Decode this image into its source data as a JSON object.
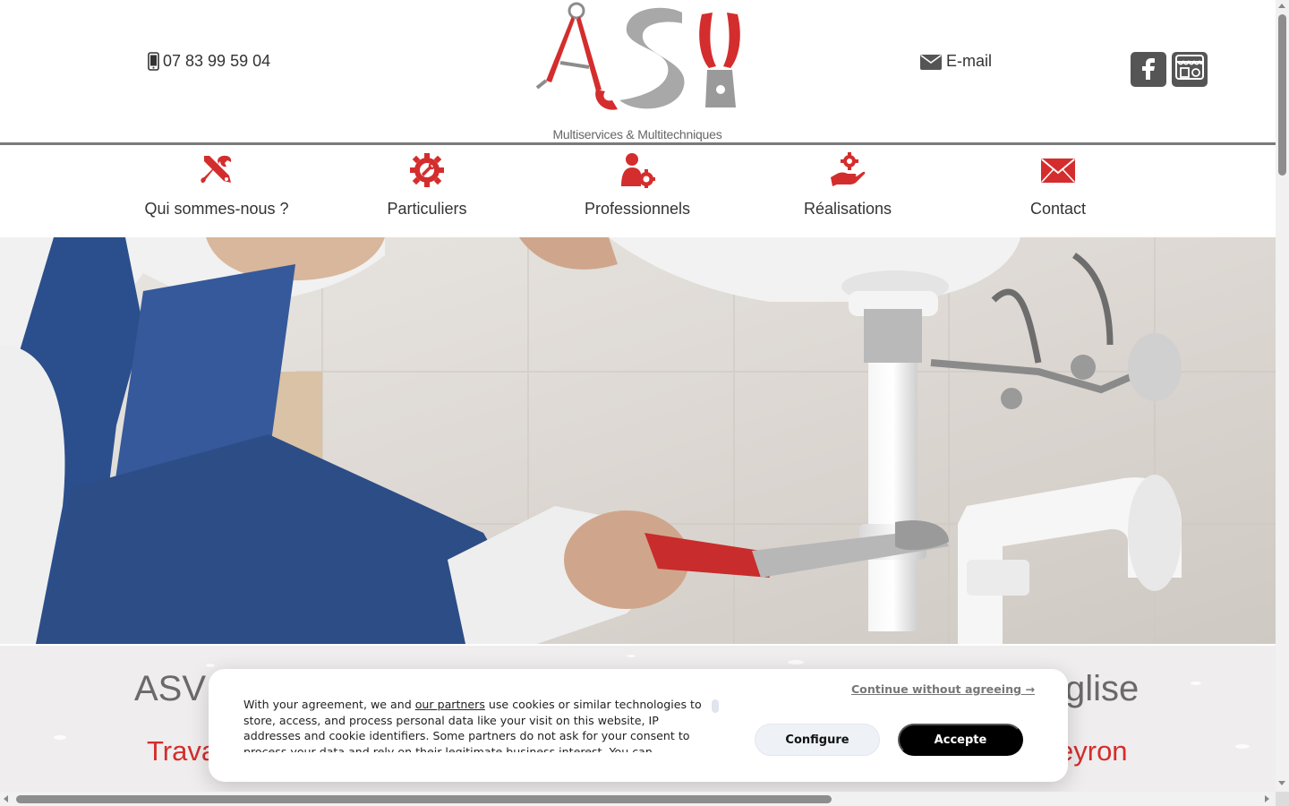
{
  "header": {
    "phone": "07 83 99 59 04",
    "email_label": "E-mail",
    "logo_tagline": "Multiservices & Multitechniques",
    "social": [
      {
        "name": "facebook",
        "icon": "facebook-icon"
      },
      {
        "name": "shop",
        "icon": "storefront-icon"
      }
    ]
  },
  "nav": {
    "items": [
      {
        "label": "Qui sommes-nous ?",
        "icon": "tools-icon"
      },
      {
        "label": "Particuliers",
        "icon": "gear-wrench-icon"
      },
      {
        "label": "Professionnels",
        "icon": "worker-gear-icon"
      },
      {
        "label": "Réalisations",
        "icon": "hand-gear-icon"
      },
      {
        "label": "Contact",
        "icon": "envelope-icon"
      }
    ]
  },
  "section": {
    "title_start": "ASV",
    "title_end": "glise",
    "subtitle_start": "Trava",
    "subtitle_end": "eyron"
  },
  "cookie": {
    "text_before_link": "With your agreement, we and ",
    "link": "our partners",
    "text_after_link": " use cookies or similar technologies to store, access, and process personal data like your visit on this website, IP addresses and cookie identifiers. Some partners do not ask for your consent to process your data and rely on their legitimate business interest. You can",
    "continue": "Continue without agreeing →",
    "configure": "Configure",
    "accept": "Accepte"
  },
  "colors": {
    "brand_red": "#d42d2d",
    "divider": "#7a7a7a",
    "icon_dark": "#555555",
    "section_bg": "#efeded"
  }
}
